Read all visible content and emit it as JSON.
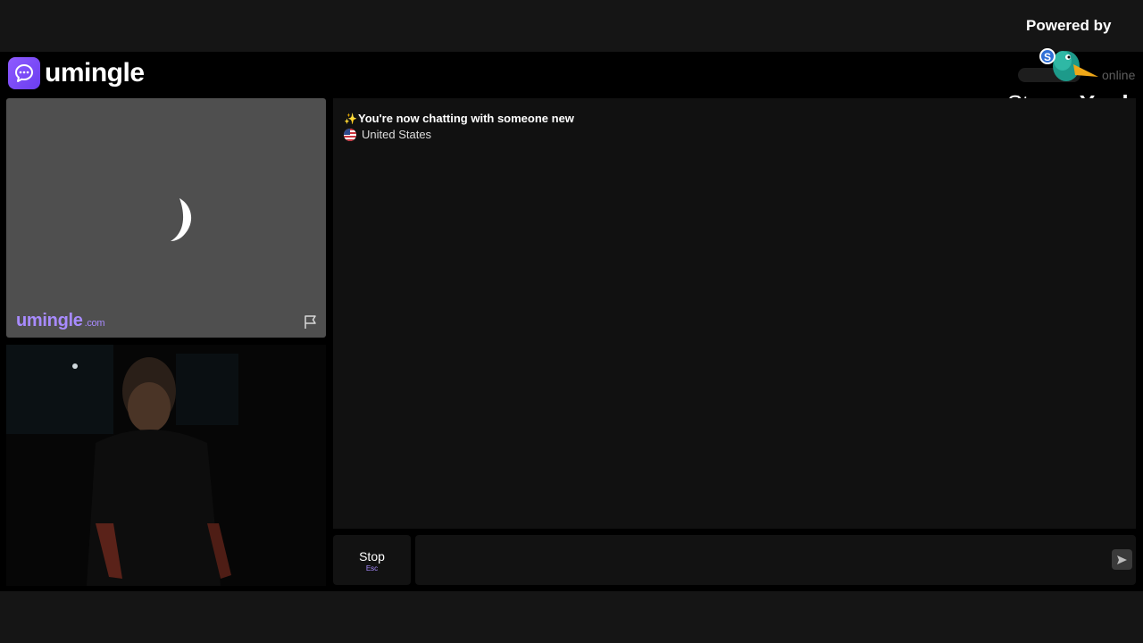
{
  "brand": {
    "name": "umingle",
    "accent": "#8f5bff"
  },
  "header": {
    "online_label": "online"
  },
  "overlay": {
    "powered_by": "Powered by",
    "streamyard_part1": "Stream",
    "streamyard_part2": "Yard"
  },
  "stranger_video": {
    "watermark": "umingle",
    "watermark_tld": ".com",
    "icons": [
      "spinner-icon",
      "flag-icon"
    ]
  },
  "self_video": {
    "description_visible": false
  },
  "chat": {
    "messages": [
      {
        "icon": "sparkle-icon",
        "text": "You're now chatting with someone new"
      },
      {
        "icon": "us-flag-icon",
        "text": "United States"
      }
    ]
  },
  "controls": {
    "stop_label": "Stop",
    "stop_hint": "Esc",
    "input_value": "",
    "input_placeholder": "",
    "send_icon": "send-icon"
  }
}
